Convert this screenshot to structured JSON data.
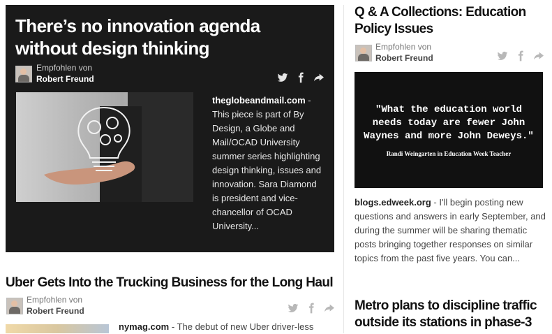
{
  "recommended_label": "Empfohlen von",
  "curator_name": "Robert Freund",
  "cards": [
    {
      "title": "There’s no innovation agenda without design thinking",
      "source": "theglobeandmail.com",
      "excerpt": " - This piece is part of By Design, a Globe and Mail/OCAD University summer series highlighting design thinking, issues and innovation. Sara Diamond is president and vice-chancellor of OCAD University..."
    },
    {
      "title": "Q & A Collections: Education Policy Issues",
      "image_quote": "\"What the education world needs today are fewer John Waynes and more John Deweys.\"",
      "image_attribution": "Randi Weingarten in Education Week Teacher",
      "source": "blogs.edweek.org",
      "excerpt": " - I'll begin posting new questions and answers in early September, and during the summer will be sharing thematic posts bringing together responses on similar topics from the past five years. You can..."
    },
    {
      "title": "Uber Gets Into the Trucking Business for the Long Haul",
      "source": "nymag.com",
      "excerpt": " - The debut of new Uber driver-less"
    },
    {
      "title": "Metro plans to discipline traffic outside its stations in phase-3"
    }
  ],
  "share_icons": [
    "twitter-icon",
    "facebook-icon",
    "share-arrow-icon"
  ]
}
